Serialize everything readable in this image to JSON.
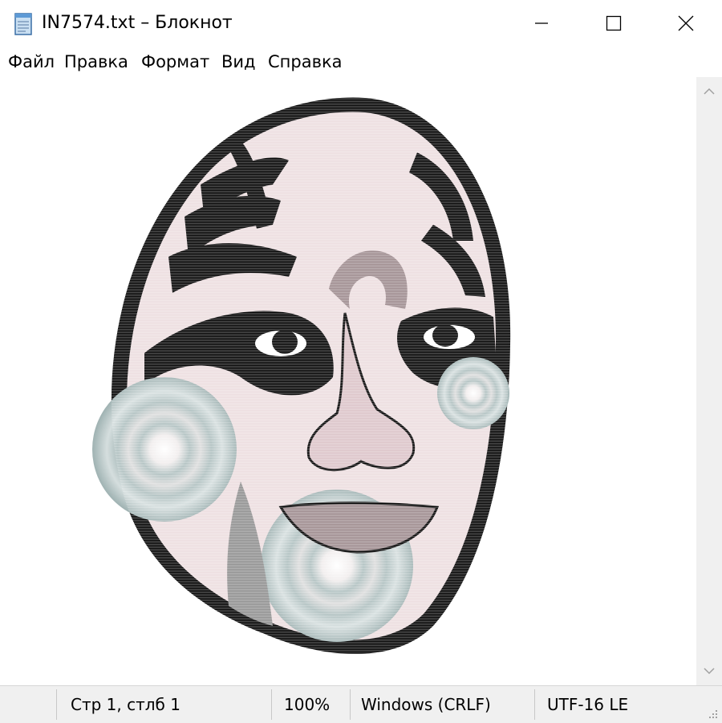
{
  "window": {
    "title": "IN7574.txt – Блокнот"
  },
  "titlebar_buttons": {
    "minimize_icon": "minimize-icon",
    "maximize_icon": "maximize-icon",
    "close_icon": "close-icon"
  },
  "menu": {
    "items": [
      "Файл",
      "Правка",
      "Формат",
      "Вид",
      "Справка"
    ]
  },
  "editor": {
    "content_description_icon": "opera-mask-ascii-art"
  },
  "statusbar": {
    "position": "Стр 1, стлб 1",
    "zoom": "100%",
    "line_endings": "Windows (CRLF)",
    "encoding": "UTF-16 LE"
  },
  "colors": {
    "mask_skin": "#ecdddf",
    "mask_black": "#000000",
    "mask_gray": "#8f8f8f",
    "mask_teal": "#aebfbf",
    "mask_mauve": "#b9a3a6"
  }
}
